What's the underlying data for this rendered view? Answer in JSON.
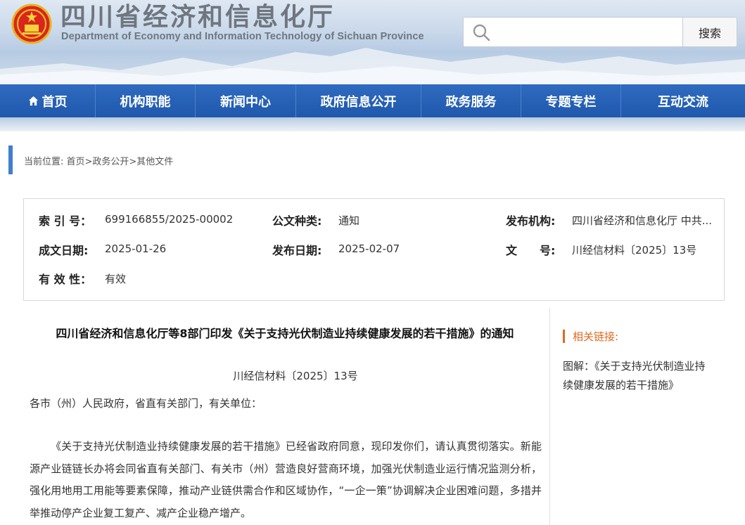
{
  "header": {
    "title": "四川省经济和信息化厅",
    "subtitle": "Department of Economy and Information Technology of Sichuan Province",
    "search_placeholder": "",
    "search_button": "搜索"
  },
  "nav": {
    "items": [
      {
        "label": "首页",
        "icon": "home-icon"
      },
      {
        "label": "机构职能"
      },
      {
        "label": "新闻中心"
      },
      {
        "label": "政府信息公开"
      },
      {
        "label": "政务服务"
      },
      {
        "label": "专题专栏"
      },
      {
        "label": "互动交流"
      }
    ]
  },
  "breadcrumb": {
    "text": "当前位置: 首页>政务公开>其他文件"
  },
  "info": {
    "index_label": "索 引 号：",
    "index_value": "699166855/2025-00002",
    "type_label": "公文种类:",
    "type_value": "通知",
    "issuer_label": "发布机构:",
    "issuer_value": "四川省经济和信息化厅 中共...",
    "created_label": "成文日期:",
    "created_value": "2025-01-26",
    "published_label": "发布日期:",
    "published_value": "2025-02-07",
    "docno_label": "文　　号:",
    "docno_value": "川经信材料〔2025〕13号",
    "validity_label": "有 效 性：",
    "validity_value": "有效"
  },
  "article": {
    "title": "四川省经济和信息化厅等8部门印发《关于支持光伏制造业持续健康发展的若干措施》的通知",
    "doc_no": "川经信材料〔2025〕13号",
    "addressee": "各市（州）人民政府，省直有关部门，有关单位：",
    "paragraph": "《关于支持光伏制造业持续健康发展的若干措施》已经省政府同意，现印发你们，请认真贯彻落实。新能源产业链链长办将会同省直有关部门、有关市（州）营造良好营商环境，加强光伏制造业运行情况监测分析，强化用地用工用能等要素保障，推动产业链供需合作和区域协作，“一企一策”协调解决企业困难问题，多措并举推动停产企业复工复产、减产企业稳产增产。"
  },
  "sidebar": {
    "title": "相关链接:",
    "link": "图解：《关于支持光伏制造业持续健康发展的若干措施》"
  },
  "colors": {
    "nav_blue": "#1f58ad",
    "accent_orange": "#e06a1e",
    "crumb_blue": "#3f7ed0"
  }
}
